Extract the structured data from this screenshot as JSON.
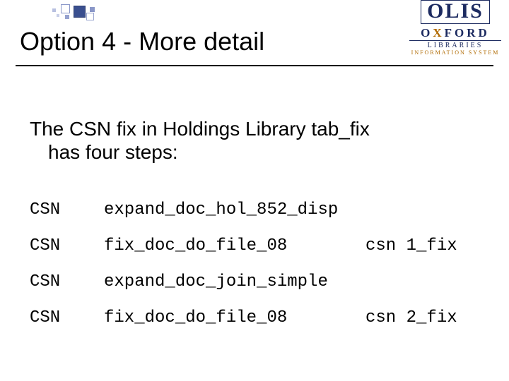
{
  "logo": {
    "olis": "OLIS",
    "ox_left": "O",
    "ox_x": "X",
    "ox_right": "FORD",
    "sub1": "LIBRARIES",
    "sub2": "INFORMATION SYSTEM"
  },
  "title": "Option 4 - More detail",
  "intro": {
    "line1": "The CSN fix in Holdings Library tab_fix",
    "line2": "has four steps:"
  },
  "rows": [
    {
      "c1": "CSN",
      "c2": "expand_doc_hol_852_disp",
      "c3": ""
    },
    {
      "c1": "CSN",
      "c2": "fix_doc_do_file_08",
      "c3": "csn 1_fix"
    },
    {
      "c1": "CSN",
      "c2": "expand_doc_join_simple",
      "c3": ""
    },
    {
      "c1": "CSN",
      "c2": "fix_doc_do_file_08",
      "c3": "csn 2_fix"
    }
  ]
}
